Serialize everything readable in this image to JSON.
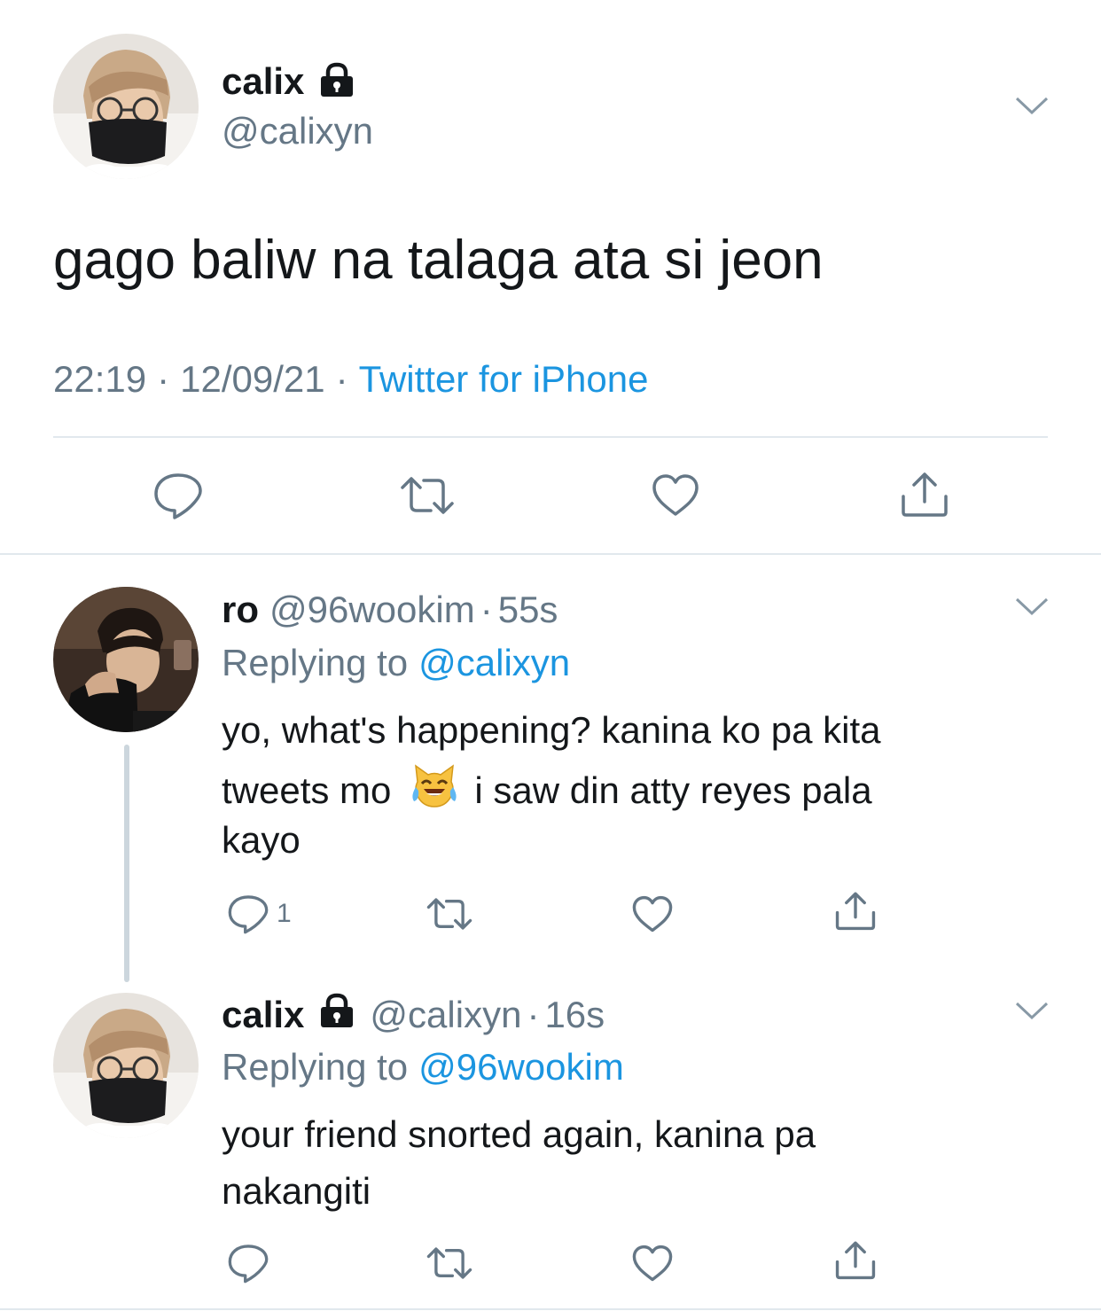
{
  "main_tweet": {
    "display_name": "calix",
    "handle": "@calixyn",
    "text": "gago baliw na talaga ata si jeon",
    "time": "22:19",
    "date": "12/09/21",
    "separator": "·",
    "source": "Twitter for iPhone"
  },
  "reply1": {
    "display_name": "ro",
    "handle": "@96wookim",
    "age": "55s",
    "replying_prefix": "Replying to",
    "replying_to": "@calixyn",
    "text_line1": "yo, what's happening? kanina ko pa kita",
    "text_line2a": "tweets mo",
    "text_line2b": "i saw din atty reyes pala",
    "text_line3": "kayo",
    "reply_count": "1"
  },
  "reply2": {
    "display_name": "calix",
    "handle": "@calixyn",
    "age": "16s",
    "replying_prefix": "Replying to",
    "replying_to": "@96wookim",
    "text_line1": "your friend snorted again, kanina pa",
    "text_line2": "nakangiti"
  },
  "colors": {
    "link": "#1b95e0",
    "secondary": "#657786",
    "icon": "#657786",
    "divider": "#e1e8ed",
    "thread_line": "#ccd6dd"
  },
  "icons": [
    "lock-icon",
    "chevron-down-icon",
    "reply-icon",
    "retweet-icon",
    "like-icon",
    "share-icon",
    "laughing-cat-emoji"
  ]
}
